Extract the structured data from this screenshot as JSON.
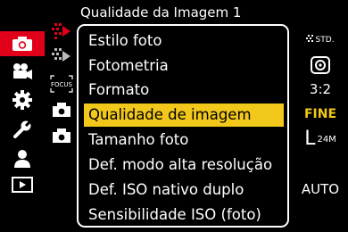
{
  "header": {
    "title": "Qualidade da Imagem 1"
  },
  "sidebar": {
    "tabs": [
      {
        "icon": "camera-icon",
        "active": true
      },
      {
        "icon": "video-camera-icon",
        "active": false
      },
      {
        "icon": "gear-icon",
        "active": false
      },
      {
        "icon": "wrench-icon",
        "active": false
      },
      {
        "icon": "person-icon",
        "active": false
      },
      {
        "icon": "playback-icon",
        "active": false
      }
    ]
  },
  "pages": {
    "icons": [
      "image-quality-page-icon",
      "focus-page-icon",
      "focus-label-icon",
      "camera-page-icon-2",
      "camera-page-icon-3"
    ],
    "focus_label": "FOCUS"
  },
  "menu": {
    "items": [
      {
        "label": "Estilo foto",
        "value": "STD.",
        "value_icon": "photo-style-icon"
      },
      {
        "label": "Fotometria",
        "value": "",
        "value_icon": "metering-icon"
      },
      {
        "label": "Formato",
        "value": "3:2"
      },
      {
        "label": "Qualidade de imagem",
        "value": "FINE",
        "selected": true
      },
      {
        "label": "Tamanho foto",
        "value_big": "L",
        "value_small": "24M"
      },
      {
        "label": "Def. modo alta resolução",
        "value": ""
      },
      {
        "label": "Def. ISO nativo duplo",
        "value": "AUTO"
      },
      {
        "label": "Sensibilidade ISO (foto)",
        "value": ""
      }
    ]
  },
  "colors": {
    "accent_red": "#e1001a",
    "highlight_yellow": "#f2c81a",
    "background": "#000000"
  }
}
